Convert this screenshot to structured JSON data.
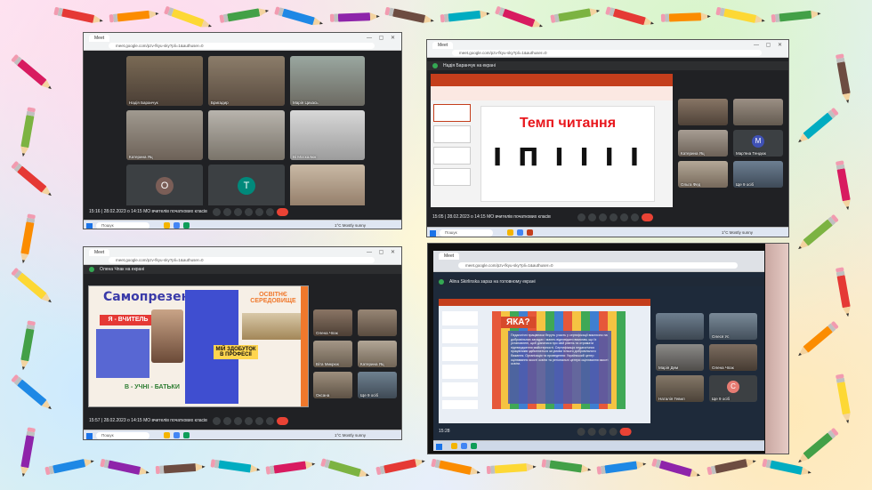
{
  "colors": {
    "meet_bg": "#202124",
    "tile_bg": "#3c4043",
    "end_call": "#ea4335",
    "slide_title_red": "#e8161c",
    "accent_orange": "#f0782c"
  },
  "common": {
    "url": "meet.google.com/pzv-fkyu-sky?pli=1&authuser=0",
    "tab_label": "Meet",
    "meeting_title": "28.02.2023 о 14:15 МО вчителів початкових класів",
    "search_label": "Пошук",
    "weather": "1°C Mostly sunny"
  },
  "screen1": {
    "time": "15:16",
    "tiles": [
      {
        "label": "Надія Баранчук"
      },
      {
        "label": "Бригадир"
      },
      {
        "label": "Марія Цихась"
      },
      {
        "label": "Катерина Яц"
      },
      {
        "label": ""
      },
      {
        "label": "Ві Москалюк"
      },
      {
        "label": "Олена Чпак",
        "avatar": "О"
      },
      {
        "label": "Ще 10 осіб",
        "avatar": "T"
      },
      {
        "label": ""
      }
    ]
  },
  "screen2": {
    "time": "15:05",
    "presenter": "Надія Баранчук на екрані",
    "slide_title": "Темп читання",
    "slide_glyph": "I П I I I I",
    "tiles": [
      {
        "label": ""
      },
      {
        "label": ""
      },
      {
        "label": "Катерина Яц"
      },
      {
        "label": "Мар'яна Тендюк",
        "avatar": "М"
      },
      {
        "label": "Ольга Фед"
      },
      {
        "label": "Ще 9 осіб"
      }
    ]
  },
  "screen3": {
    "time": "15:57",
    "presenter": "Олена Чпак на екрані",
    "slide_title": "Самопрезентація",
    "badge": "Я - ВЧИТЕЛЬ",
    "panel_title": "ОСВІТНЄ СЕРЕДОВИЩЕ",
    "panel2_title": "МІЙ ЗДОБУТОК В ПРОФЕСІЇ",
    "footer_text": "В - УЧНІ - БАТЬКИ",
    "tiles": [
      {
        "label": "Олена Чпак"
      },
      {
        "label": ""
      },
      {
        "label": "Віта Микрюк"
      },
      {
        "label": "Катерина Яц"
      },
      {
        "label": "Оксана"
      },
      {
        "label": "Ще 9 осіб"
      }
    ]
  },
  "screen4": {
    "time": "15:28",
    "presenter": "Alina Skirlinska зараз на головному екрані",
    "slide_title": "ЯКА?",
    "slide_body": "Педагогічні працівники беруть участь у сертифікації виключно на добровільних засадах і мають відповідати вимогам, що їх установлені, щоб дізнатися про свій рівень та отримати підтвердження майстерності. Сертифікація педагогічних працівників здійснюється за умови їхнього добровільного бажання. Організація та проведення: Український центр оцінювання якості освіти та регіональні центри оцінювання якості освіти.",
    "tiles": [
      {
        "label": ""
      },
      {
        "label": "Олеся Ус"
      },
      {
        "label": "Марія Дем"
      },
      {
        "label": "Олена Чпак"
      },
      {
        "label": "Наталія Гевил"
      },
      {
        "label": "Ще 9 осіб",
        "avatar": "С"
      }
    ]
  }
}
